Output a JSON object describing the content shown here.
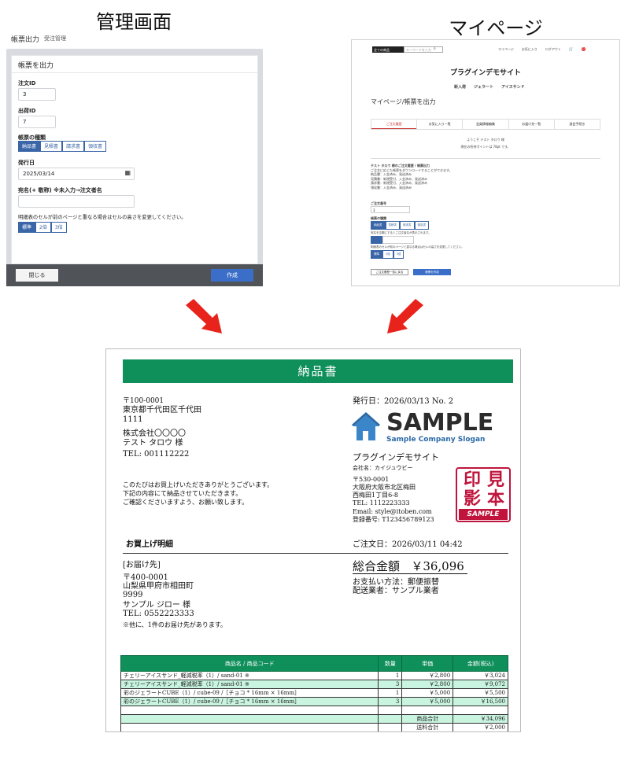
{
  "captions": {
    "admin": "管理画面",
    "mypage": "マイページ"
  },
  "admin": {
    "header_title": "帳票出力",
    "header_sub": "受注管理",
    "card_title": "帳票を出力",
    "order_id_label": "注文ID",
    "order_id_value": "3",
    "shipping_id_label": "出荷ID",
    "shipping_id_value": "7",
    "type_label": "帳票の種類",
    "types": [
      "納品書",
      "見積書",
      "請求書",
      "領収書"
    ],
    "issue_date_label": "発行日",
    "issue_date_value": "2025/03/14",
    "addressee_label": "宛名(+ 敬称)  ※未入力→注文者名",
    "addressee_value": "",
    "row_height_label": "明細表のセルが前のページと重なる場合はセルの高さを変更してください。",
    "row_height_options": [
      "標準",
      "2倍",
      "3倍"
    ],
    "close_button": "閉じる",
    "create_button": "作成"
  },
  "mypage": {
    "search_category": "全ての商品",
    "search_placeholder": "キーワードを入力",
    "nav_links": [
      "マイページ",
      "お気に入り",
      "ログアウト"
    ],
    "cart_count": "0",
    "site_title": "プラグインデモサイト",
    "menu": [
      "新入荷",
      "ジェラート",
      "アイスサンド"
    ],
    "page_title": "マイページ/帳票を出力",
    "tabs": [
      "ご注文履歴",
      "お気に入り一覧",
      "会員情報編集",
      "お届け先一覧",
      "退会手続き"
    ],
    "welcome": "ようこそ テスト タロウ 様",
    "points": "現在の所持ポイントは 78pt です。",
    "order_info": [
      "テスト タロウ 様のご注文履歴 / 帳票出力",
      "ご注文に応じた帳票をダウンロードすることができます。",
      "納品書：入金済み、発送済み",
      "見積書：新規受付、入金済み、発送済み",
      "請求書：新規受付、入金済み、発送済み",
      "領収書：入金済み、発送済み"
    ],
    "order_no_label": "ご注文番号",
    "order_no_value": "3",
    "type_label": "帳票の種類",
    "types": [
      "納品書",
      "見積書",
      "請求書",
      "領収書"
    ],
    "desc1": "宛名を空欄にするとご注文者名が表示されます。",
    "desc2": "明細表のセルが前のページと重なる場合はセルの高さを変更してください。",
    "row_opts": [
      "標準",
      "2倍",
      "3倍"
    ],
    "back_button": "ご注文履歴一覧に戻る",
    "output_button": "帳票を作成"
  },
  "doc": {
    "title": "納品書",
    "postal": "〒100-0001",
    "addr1": "東京都千代田区千代田",
    "addr2": "1111",
    "company": "株式会社〇〇〇〇",
    "person": "テスト  タロウ  様",
    "tel": "TEL: 001112222",
    "greet1": "このたびはお買上げいただきありがとうございます。",
    "greet2": "下記の内容にて納品させていただきます。",
    "greet3": "ご確認くださいますよう、お願い致します。",
    "issue": "発行日：2026/03/13   No. 2",
    "logo_main": "SAMPLE",
    "logo_sub": "Sample Company Slogan",
    "shop_name": "プラグインデモサイト",
    "shop_company": "会社名：カイジュウビー",
    "shop_postal": "〒530-0001",
    "shop_addr1": "大阪府大阪市北区梅田",
    "shop_addr2": "西梅田1丁目6-8",
    "shop_tel": "TEL: 1112223333",
    "shop_email": "Email: style@itoben.com",
    "shop_reg": "登録番号: T123456789123",
    "stamp_chars": [
      "印",
      "見",
      "影",
      "本"
    ],
    "stamp_sample": "SAMPLE",
    "purchase_label": "お買上げ明細",
    "order_date": "ご注文日：2026/03/11 04:42",
    "ship_label": "[お届け先]",
    "ship_postal": "〒400-0001",
    "ship_addr1": "山梨県甲府市相田町",
    "ship_addr2": "9999",
    "ship_person": "サンプル  ジロー  様",
    "ship_tel": "TEL: 0552223333",
    "ship_note": "※他に、1件のお届け先があります。",
    "total_label": "総合金額",
    "total_value": "￥36,096",
    "payment": "お支払い方法：郵便振替",
    "carrier": "配送業者：サンプル業者",
    "table_headers": [
      "商品名 / 商品コード",
      "数量",
      "単価",
      "金額(税込)"
    ],
    "rows": [
      [
        "チェリーアイスサンド_軽減税率（1）/ sand-01 ※",
        "1",
        "￥2,800",
        "￥3,024"
      ],
      [
        "チェリーアイスサンド_軽減税率（1）/ sand-01 ※",
        "3",
        "￥2,800",
        "￥9,072"
      ],
      [
        "彩のジェラートCUBE（1）/ cube-09 /［チョコ * 16mm × 16mm］",
        "1",
        "￥5,000",
        "￥5,500"
      ],
      [
        "彩のジェラートCUBE（1）/ cube-09 /［チョコ * 16mm × 16mm］",
        "3",
        "￥5,000",
        "￥16,500"
      ],
      [
        "",
        "",
        "",
        ""
      ],
      [
        "",
        "",
        "商品合計",
        "￥34,096"
      ],
      [
        "",
        "",
        "送料合計",
        "￥2,000"
      ]
    ]
  }
}
